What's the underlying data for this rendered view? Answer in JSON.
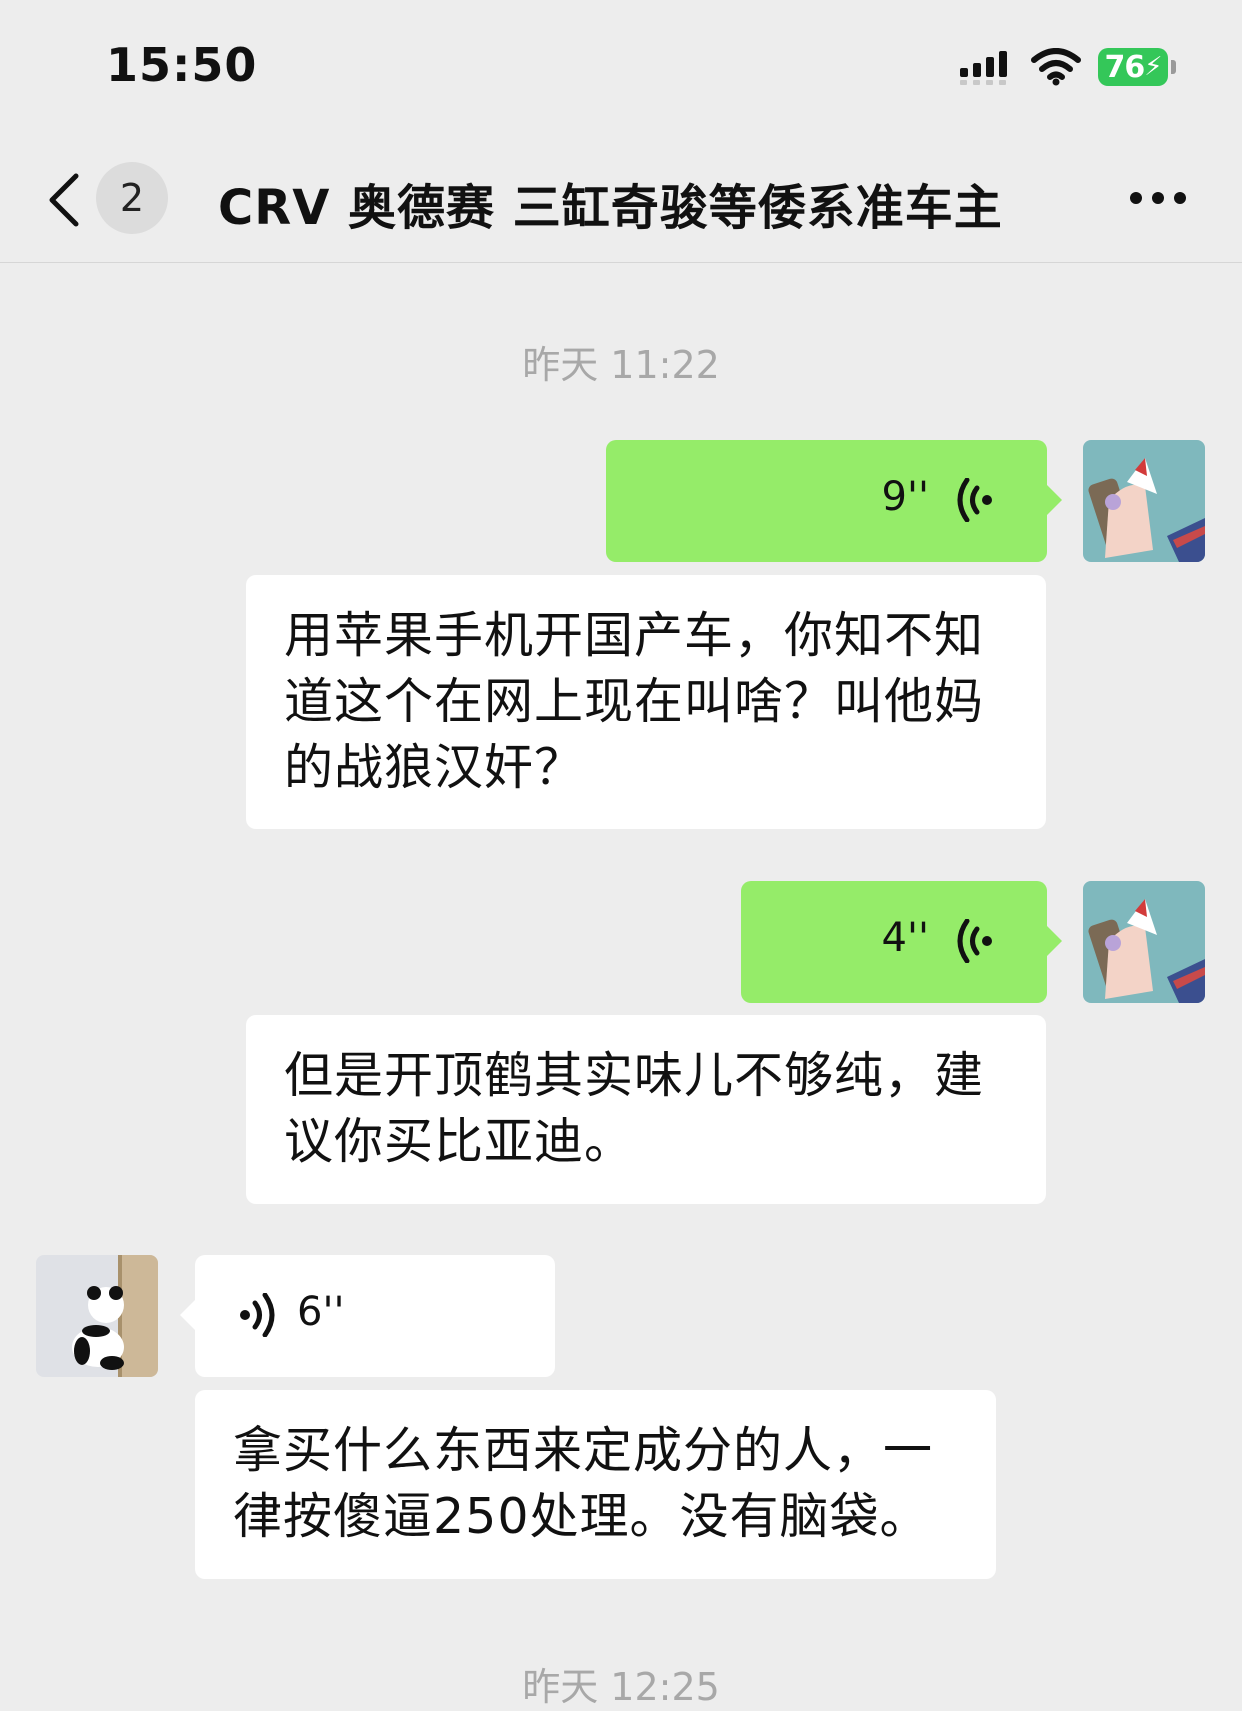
{
  "status_bar": {
    "time": "15:50",
    "battery": "76"
  },
  "nav": {
    "unread_count": "2",
    "title": "CRV 奥德赛 三缸奇骏等倭系准车主"
  },
  "timestamps": [
    "昨天 11:22",
    "昨天 12:25"
  ],
  "messages": [
    {
      "type": "voice",
      "direction": "outgoing",
      "duration": "9''"
    },
    {
      "type": "text",
      "text": "用苹果手机开国产车，你知不知道这个在网上现在叫啥？叫他妈的战狼汉奸？"
    },
    {
      "type": "voice",
      "direction": "outgoing",
      "duration": "4''"
    },
    {
      "type": "text",
      "text": "但是开顶鹤其实味儿不够纯，建议你买比亚迪。"
    },
    {
      "type": "voice",
      "direction": "incoming",
      "duration": "6''"
    },
    {
      "type": "text",
      "text": "拿买什么东西来定成分的人，一律按傻逼250处理。没有脑袋。"
    }
  ],
  "colors": {
    "outgoing_bubble": "#95ec69",
    "incoming_bubble": "#ffffff",
    "background": "#ededed"
  }
}
